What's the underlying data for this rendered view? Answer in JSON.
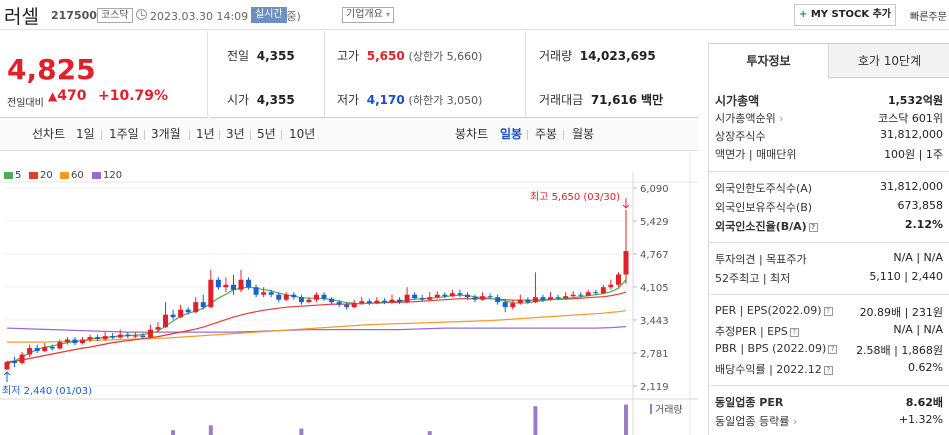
{
  "header": {
    "stock_name": "러셀",
    "stock_code": "217500",
    "market": "코스닥",
    "datetime": "2023.03.30 14:09 기준(장중)",
    "realtime": "실시간",
    "company_overview": "기업개요",
    "mystock": "MY STOCK 추가",
    "quick_order": "빠른주문"
  },
  "price": {
    "current": "4,825",
    "vs_label": "전일대비",
    "change": "470",
    "change_pct": "+10.79%"
  },
  "summary": {
    "prev_label": "전일",
    "prev": "4,355",
    "open_label": "시가",
    "open": "4,355",
    "high_label": "고가",
    "high": "5,650",
    "upper_limit": "(상한가 5,660)",
    "low_label": "저가",
    "low": "4,170",
    "lower_limit": "(하한가 3,050)",
    "volume_label": "거래량",
    "volume": "14,023,695",
    "amount_label": "거래대금",
    "amount": "71,616",
    "amount_unit": "백만"
  },
  "tabs": {
    "line_label": "선차트",
    "line_periods": [
      "1일",
      "1주일",
      "3개월",
      "1년",
      "3년",
      "5년",
      "10년"
    ],
    "candle_label": "봉차트",
    "candle_periods": [
      "일봉",
      "주봉",
      "월봉"
    ],
    "candle_active": "일봉"
  },
  "chart_data": {
    "type": "candlestick",
    "legend": [
      {
        "name": "5",
        "color": "#4caf50"
      },
      {
        "name": "20",
        "color": "#e53935"
      },
      {
        "name": "60",
        "color": "#f59b2b"
      },
      {
        "name": "120",
        "color": "#9c6ad1"
      }
    ],
    "y_ticks": [
      "6,090",
      "5,429",
      "4,767",
      "4,105",
      "3,443",
      "2,781",
      "2,119"
    ],
    "ylim": [
      2119,
      6090
    ],
    "high_annotation": "최고 5,650 (03/30)",
    "low_annotation": "최저 2,440 (01/03)",
    "volume_label": "거래량",
    "candles": [
      [
        2450,
        2600,
        2440,
        2620
      ],
      [
        2620,
        2580,
        2500,
        2700
      ],
      [
        2580,
        2750,
        2550,
        2800
      ],
      [
        2750,
        2880,
        2700,
        2950
      ],
      [
        2880,
        2820,
        2780,
        2950
      ],
      [
        2820,
        2900,
        2800,
        2980
      ],
      [
        2900,
        2870,
        2830,
        2950
      ],
      [
        2870,
        3000,
        2850,
        3050
      ],
      [
        3000,
        3050,
        2950,
        3100
      ],
      [
        3050,
        2980,
        2940,
        3100
      ],
      [
        2980,
        3050,
        2950,
        3100
      ],
      [
        3050,
        3100,
        3000,
        3150
      ],
      [
        3100,
        3060,
        3020,
        3150
      ],
      [
        3060,
        3120,
        3030,
        3200
      ],
      [
        3120,
        3090,
        3060,
        3180
      ],
      [
        3090,
        3150,
        3070,
        3250
      ],
      [
        3150,
        3120,
        3080,
        3200
      ],
      [
        3120,
        3130,
        3080,
        3200
      ],
      [
        3130,
        3100,
        3070,
        3180
      ],
      [
        3100,
        3250,
        3090,
        3350
      ],
      [
        3250,
        3300,
        3200,
        3400
      ],
      [
        3300,
        3550,
        3280,
        3800
      ],
      [
        3550,
        3500,
        3450,
        3650
      ],
      [
        3500,
        3650,
        3480,
        3750
      ],
      [
        3650,
        3600,
        3550,
        3700
      ],
      [
        3600,
        3800,
        3580,
        3900
      ],
      [
        3800,
        3700,
        3650,
        3950
      ],
      [
        3700,
        4250,
        3680,
        4450
      ],
      [
        4250,
        4100,
        4050,
        4300
      ],
      [
        4100,
        4150,
        4000,
        4300
      ],
      [
        4150,
        4050,
        3950,
        4350
      ],
      [
        4050,
        4250,
        4000,
        4450
      ],
      [
        4250,
        4100,
        4050,
        4300
      ],
      [
        4100,
        3950,
        3900,
        4150
      ],
      [
        3950,
        4000,
        3900,
        4100
      ],
      [
        4000,
        3950,
        3900,
        4050
      ],
      [
        3950,
        3850,
        3800,
        4000
      ],
      [
        3850,
        3950,
        3820,
        4000
      ],
      [
        3950,
        3900,
        3850,
        4000
      ],
      [
        3900,
        3800,
        3750,
        3950
      ],
      [
        3800,
        3850,
        3780,
        3900
      ],
      [
        3850,
        3950,
        3800,
        4000
      ],
      [
        3950,
        3870,
        3830,
        4000
      ],
      [
        3870,
        3800,
        3750,
        3900
      ],
      [
        3800,
        3750,
        3700,
        3850
      ],
      [
        3750,
        3700,
        3650,
        3800
      ],
      [
        3700,
        3780,
        3680,
        3850
      ],
      [
        3780,
        3820,
        3750,
        3900
      ],
      [
        3820,
        3780,
        3740,
        3870
      ],
      [
        3780,
        3830,
        3760,
        3900
      ],
      [
        3830,
        3800,
        3760,
        3880
      ],
      [
        3800,
        3850,
        3780,
        3950
      ],
      [
        3850,
        3800,
        3760,
        3900
      ],
      [
        3800,
        3950,
        3780,
        4100
      ],
      [
        3950,
        3880,
        3850,
        4000
      ],
      [
        3880,
        3850,
        3820,
        3950
      ],
      [
        3850,
        3900,
        3830,
        4000
      ],
      [
        3900,
        3950,
        3870,
        4020
      ],
      [
        3950,
        3920,
        3880,
        4000
      ],
      [
        3920,
        3980,
        3900,
        4050
      ],
      [
        3980,
        3950,
        3900,
        4050
      ],
      [
        3950,
        3900,
        3850,
        4000
      ],
      [
        3900,
        3850,
        3800,
        3950
      ],
      [
        3850,
        3920,
        3830,
        4000
      ],
      [
        3920,
        3900,
        3860,
        3980
      ],
      [
        3900,
        3800,
        3750,
        3950
      ],
      [
        3800,
        3700,
        3600,
        3850
      ],
      [
        3700,
        3780,
        3650,
        3850
      ],
      [
        3780,
        3850,
        3750,
        3950
      ],
      [
        3850,
        3800,
        3760,
        3900
      ],
      [
        3800,
        3900,
        3780,
        4400
      ],
      [
        3900,
        3850,
        3800,
        3950
      ],
      [
        3850,
        3900,
        3830,
        4000
      ],
      [
        3900,
        3880,
        3840,
        3950
      ],
      [
        3880,
        3920,
        3860,
        4000
      ],
      [
        3920,
        3950,
        3900,
        4020
      ],
      [
        3950,
        3930,
        3900,
        4000
      ],
      [
        3930,
        4000,
        3920,
        4050
      ],
      [
        4000,
        3980,
        3950,
        4050
      ],
      [
        3980,
        4100,
        3960,
        4150
      ],
      [
        4100,
        4150,
        4050,
        4250
      ],
      [
        4150,
        4355,
        4100,
        4400
      ],
      [
        4355,
        4825,
        4170,
        5650
      ]
    ],
    "ma": {
      "5": [
        2550,
        2620,
        2700,
        2780,
        2850,
        2900,
        2920,
        2960,
        2990,
        3010,
        3030,
        3060,
        3080,
        3090,
        3110,
        3120,
        3130,
        3140,
        3150,
        3180,
        3220,
        3320,
        3420,
        3520,
        3580,
        3620,
        3680,
        3780,
        3880,
        3960,
        4050,
        4080,
        4100,
        4080,
        4050,
        4030,
        3980,
        3950,
        3920,
        3890,
        3880,
        3880,
        3870,
        3850,
        3820,
        3790,
        3780,
        3770,
        3780,
        3790,
        3800,
        3810,
        3820,
        3840,
        3860,
        3870,
        3880,
        3890,
        3910,
        3930,
        3940,
        3930,
        3910,
        3890,
        3880,
        3850,
        3820,
        3790,
        3780,
        3790,
        3810,
        3830,
        3850,
        3870,
        3880,
        3890,
        3910,
        3930,
        3950,
        3970,
        4010,
        4080,
        4250
      ],
      "20": [
        2600,
        2620,
        2640,
        2670,
        2700,
        2730,
        2760,
        2790,
        2820,
        2850,
        2880,
        2900,
        2930,
        2960,
        2990,
        3010,
        3030,
        3050,
        3070,
        3090,
        3110,
        3140,
        3170,
        3200,
        3230,
        3260,
        3300,
        3350,
        3400,
        3450,
        3500,
        3540,
        3580,
        3610,
        3640,
        3660,
        3680,
        3700,
        3710,
        3720,
        3730,
        3740,
        3750,
        3760,
        3760,
        3760,
        3770,
        3770,
        3780,
        3780,
        3790,
        3790,
        3800,
        3800,
        3810,
        3820,
        3830,
        3840,
        3850,
        3860,
        3870,
        3870,
        3870,
        3870,
        3870,
        3860,
        3850,
        3840,
        3840,
        3840,
        3840,
        3850,
        3850,
        3860,
        3860,
        3870,
        3880,
        3890,
        3900,
        3910,
        3930,
        3960,
        4000
      ],
      "60": [
        3000,
        3000,
        3000,
        3000,
        3000,
        3000,
        3005,
        3010,
        3015,
        3020,
        3025,
        3030,
        3035,
        3040,
        3045,
        3050,
        3055,
        3060,
        3065,
        3070,
        3075,
        3080,
        3090,
        3100,
        3110,
        3120,
        3130,
        3140,
        3150,
        3160,
        3170,
        3180,
        3190,
        3200,
        3210,
        3220,
        3230,
        3240,
        3250,
        3260,
        3270,
        3280,
        3290,
        3300,
        3310,
        3320,
        3330,
        3340,
        3350,
        3355,
        3360,
        3365,
        3370,
        3375,
        3380,
        3385,
        3390,
        3395,
        3400,
        3405,
        3410,
        3415,
        3420,
        3425,
        3430,
        3440,
        3450,
        3460,
        3470,
        3480,
        3490,
        3500,
        3510,
        3520,
        3530,
        3540,
        3550,
        3560,
        3570,
        3580,
        3595,
        3610,
        3630
      ],
      "120": [
        3280,
        3275,
        3270,
        3265,
        3260,
        3255,
        3250,
        3245,
        3240,
        3235,
        3230,
        3225,
        3220,
        3215,
        3210,
        3205,
        3200,
        3200,
        3200,
        3200,
        3200,
        3200,
        3200,
        3200,
        3200,
        3200,
        3200,
        3200,
        3200,
        3200,
        3200,
        3205,
        3210,
        3215,
        3220,
        3225,
        3230,
        3235,
        3240,
        3245,
        3250,
        3250,
        3250,
        3250,
        3250,
        3250,
        3250,
        3250,
        3250,
        3250,
        3250,
        3250,
        3250,
        3255,
        3260,
        3265,
        3270,
        3275,
        3280,
        3280,
        3280,
        3280,
        3280,
        3280,
        3280,
        3280,
        3280,
        3280,
        3280,
        3280,
        3280,
        3280,
        3280,
        3280,
        3280,
        3280,
        3280,
        3280,
        3280,
        3285,
        3290,
        3300,
        3310
      ]
    },
    "volume_bars": [
      {
        "index": 22,
        "value": 0.15
      },
      {
        "index": 27,
        "value": 0.3
      },
      {
        "index": 39,
        "value": 0.2
      },
      {
        "index": 70,
        "value": 0.9
      },
      {
        "index": 82,
        "value": 0.95
      },
      {
        "index": 56,
        "value": 0.12
      }
    ]
  },
  "side": {
    "tab_invest": "투자정보",
    "tab_orderbook": "호가 10단계",
    "market_cap_label": "시가총액",
    "market_cap": "1,532억원",
    "cap_rank_label": "시가총액순위",
    "cap_rank": "코스닥 601위",
    "shares_label": "상장주식수",
    "shares": "31,812,000",
    "par_label": "액면가 | 매매단위",
    "par": "100원 | 1주",
    "foreign_limit_label": "외국인한도주식수(A)",
    "foreign_limit": "31,812,000",
    "foreign_hold_label": "외국인보유주식수(B)",
    "foreign_hold": "673,858",
    "foreign_ratio_label": "외국인소진율(B/A)",
    "foreign_ratio": "2.12%",
    "opinion_label": "투자의견 | 목표주가",
    "opinion": "N/A | N/A",
    "week52_label": "52주최고 | 최저",
    "week52": "5,110 | 2,440",
    "per_label": "PER | EPS(2022.09)",
    "per": "20.89배 | 231원",
    "est_per_label": "추정PER | EPS",
    "est_per": "N/A | N/A",
    "pbr_label": "PBR | BPS (2022.09)",
    "pbr": "2.58배 | 1,868원",
    "div_label": "배당수익률 | 2022.12",
    "div": "0.62%",
    "sector_per_label": "동일업종 PER",
    "sector_per": "8.62배",
    "sector_chg_label": "동일업종 등락률",
    "sector_chg": "+1.32%"
  }
}
